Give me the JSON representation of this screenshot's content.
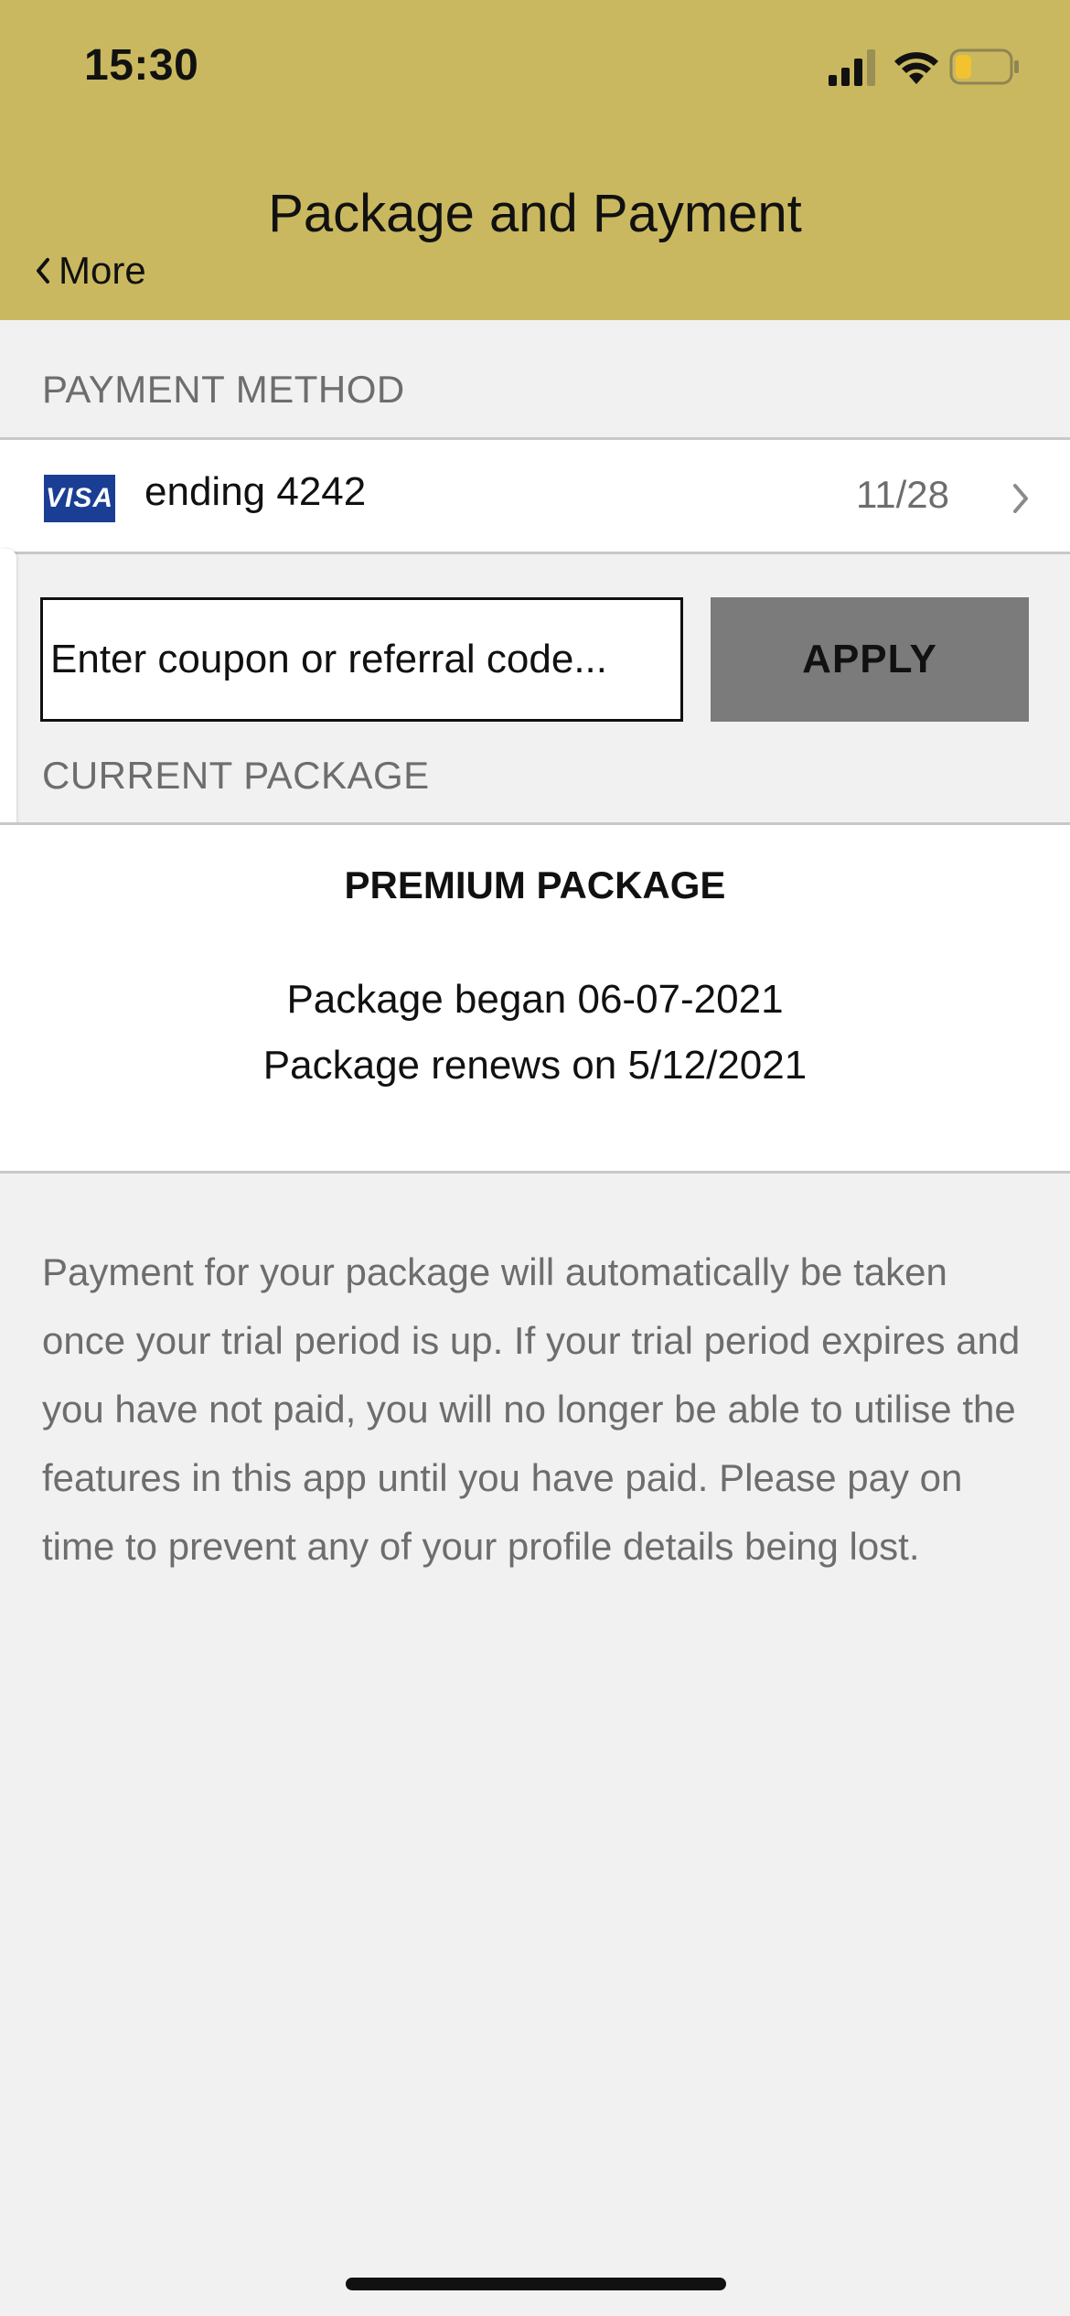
{
  "status_bar": {
    "time": "15:30",
    "icons": [
      "signal-icon",
      "wifi-icon",
      "battery-icon"
    ]
  },
  "nav": {
    "back_label": "More",
    "title": "Package and Payment"
  },
  "payment_method": {
    "section_label": "PAYMENT METHOD",
    "card_brand": "VISA",
    "card_ending": "ending 4242",
    "expiry": "11/28"
  },
  "coupon": {
    "placeholder": "Enter coupon or referral code...",
    "value": "",
    "apply_label": "APPLY"
  },
  "current_package": {
    "section_label": "CURRENT PACKAGE",
    "name": "PREMIUM PACKAGE",
    "began": "Package began 06-07-2021",
    "renews": "Package renews on 5/12/2021"
  },
  "info_text": "Payment for your package will automatically be taken once your trial period is up. If your trial period expires and you have not paid, you will no longer be able to utilise the features in this app until you have paid. Please pay on time to prevent any of your profile details being lost.",
  "colors": {
    "header_background": "#c9b85f",
    "page_background": "#f1f1f1",
    "apply_button": "#7b7b7b",
    "visa_blue": "#1a3e94",
    "battery_level": "#f2c230"
  },
  "battery_level": 0.3
}
